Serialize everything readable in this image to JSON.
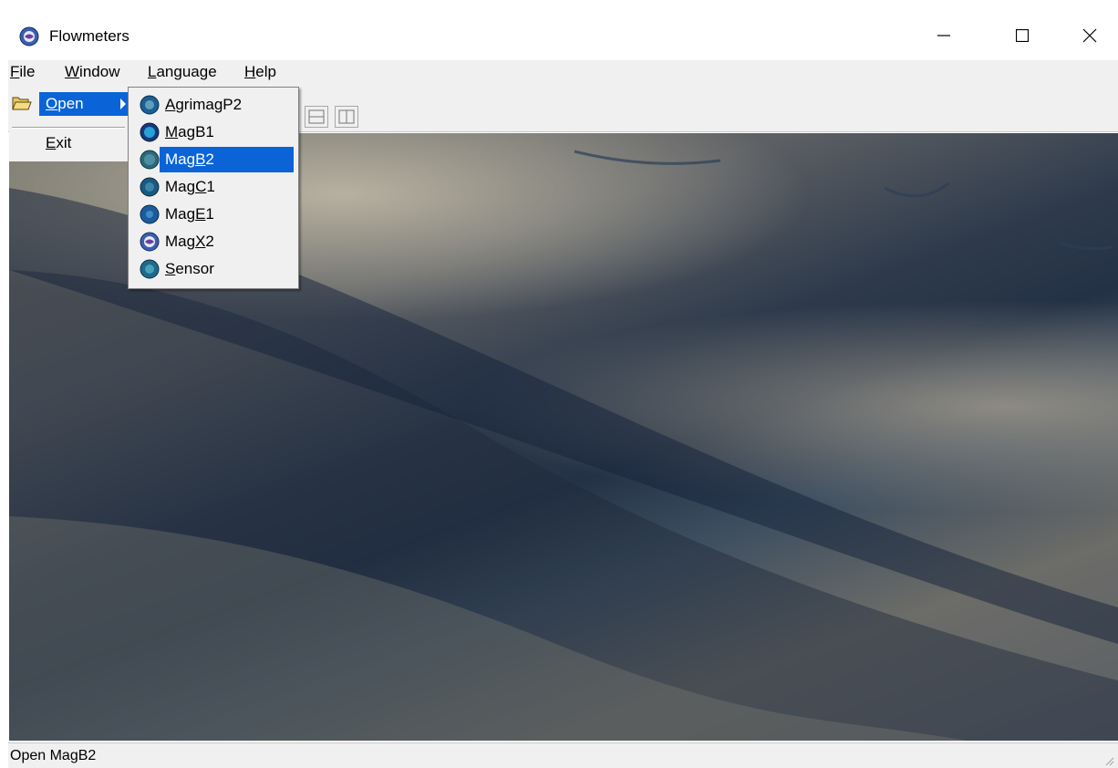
{
  "window": {
    "title": "Flowmeters",
    "app_icon": "flowmeter-app-icon",
    "controls": [
      "minimize-icon",
      "maximize-icon",
      "close-icon"
    ]
  },
  "menubar": {
    "items": [
      {
        "label": "File",
        "underline": "F",
        "rest": "ile"
      },
      {
        "label": "Window",
        "underline": "W",
        "rest": "indow"
      },
      {
        "label": "Language",
        "underline": "L",
        "rest": "anguage"
      },
      {
        "label": "Help",
        "underline": "H",
        "rest": "elp"
      }
    ]
  },
  "file_menu": {
    "open": {
      "label": "Open",
      "underline": "O",
      "rest": "pen"
    },
    "exit": {
      "label": "Exit",
      "underline": "E",
      "rest": "xit"
    }
  },
  "open_submenu": {
    "items": [
      {
        "label": "AgrimagP2",
        "pre": "",
        "u": "A",
        "post": "grimagP2",
        "icon": "agrimag-icon",
        "active": false
      },
      {
        "label": "MagB1",
        "pre": "",
        "u": "M",
        "post": "agB1",
        "icon": "magb1-icon",
        "active": false
      },
      {
        "label": "MagB2",
        "pre": "Mag",
        "u": "B",
        "post": "2",
        "icon": "magb2-icon",
        "active": true
      },
      {
        "label": "MagC1",
        "pre": "Mag",
        "u": "C",
        "post": "1",
        "icon": "magc1-icon",
        "active": false
      },
      {
        "label": "MagE1",
        "pre": "Mag",
        "u": "E",
        "post": "1",
        "icon": "mage1-icon",
        "active": false
      },
      {
        "label": "MagX2",
        "pre": "Mag",
        "u": "X",
        "post": "2",
        "icon": "magx2-icon",
        "active": false
      },
      {
        "label": "Sensor",
        "pre": "",
        "u": "S",
        "post": "ensor",
        "icon": "sensor-icon",
        "active": false
      }
    ]
  },
  "toolbar": {
    "buttons": [
      "tile-horizontal-icon",
      "tile-vertical-icon"
    ]
  },
  "statusbar": {
    "text": "Open MagB2"
  },
  "colors": {
    "highlight": "#0a64d8",
    "menu_bg": "#f0f0f0"
  }
}
